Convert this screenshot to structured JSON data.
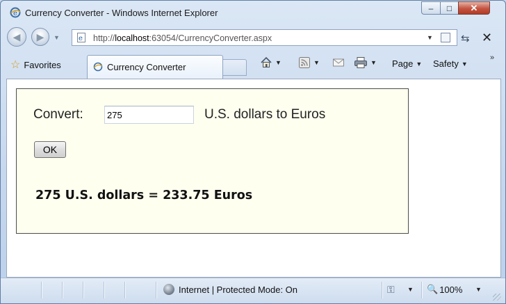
{
  "window": {
    "title": "Currency Converter - Windows Internet Explorer",
    "controls": {
      "minimize": "–",
      "maximize": "□",
      "close": "✕"
    }
  },
  "navigation": {
    "address": {
      "prefix": "http://",
      "host": "localhost",
      "rest": ":63054/CurrencyConverter.aspx"
    }
  },
  "command_bar": {
    "favorites_label": "Favorites",
    "tab_label": "Currency Converter",
    "page_label": "Page",
    "safety_label": "Safety"
  },
  "page": {
    "convert_label": "Convert:",
    "amount_value": "275",
    "unit_text": "U.S. dollars to Euros",
    "ok_label": "OK",
    "result_text": "275 U.S. dollars = 233.75 Euros",
    "panel_bg": "#fffff0"
  },
  "status_bar": {
    "zone_text": "Internet | Protected Mode: On",
    "zoom_text": "100%"
  },
  "icons": [
    "ie-logo-icon",
    "back-icon",
    "forward-icon",
    "compatibility-icon",
    "refresh-icon",
    "stop-icon",
    "favorites-star-icon",
    "home-icon",
    "feeds-icon",
    "mail-icon",
    "print-icon",
    "globe-icon",
    "protected-mode-icon",
    "zoom-icon"
  ]
}
